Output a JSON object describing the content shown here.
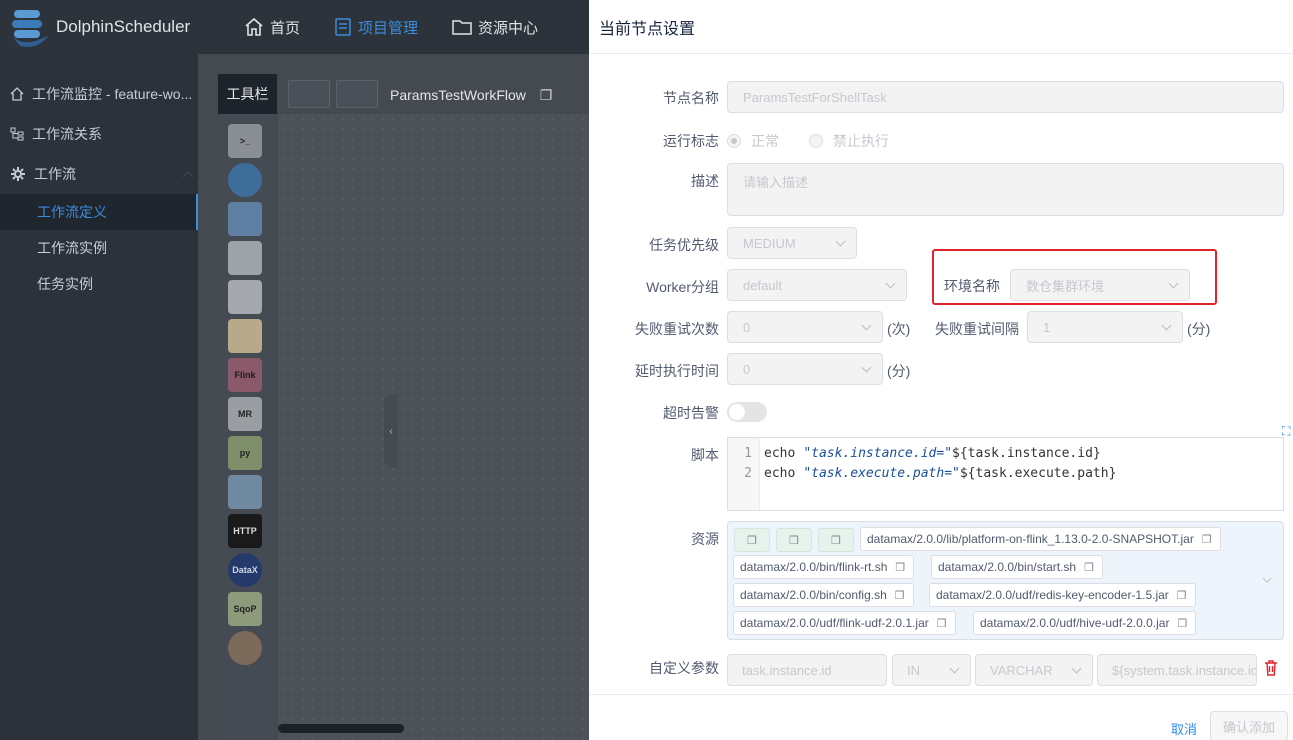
{
  "app": {
    "brand": "DolphinScheduler",
    "nav": [
      {
        "label": "首页",
        "icon": "home-icon"
      },
      {
        "label": "项目管理",
        "icon": "project-icon"
      },
      {
        "label": "资源中心",
        "icon": "folder-icon"
      }
    ]
  },
  "sidebar": {
    "items": [
      {
        "label": "工作流监控 - feature-wo..."
      },
      {
        "label": "工作流关系"
      },
      {
        "label": "工作流"
      }
    ],
    "sub_items": [
      {
        "label": "工作流定义"
      },
      {
        "label": "工作流实例"
      },
      {
        "label": "任务实例"
      }
    ]
  },
  "canvas": {
    "toolbar_title": "工具栏",
    "workflow_name": "ParamsTestWorkFlow",
    "tool_labels": [
      "Flink",
      "MR",
      "py",
      "HTTP",
      "DataX",
      "SqoP"
    ]
  },
  "drawer": {
    "title": "当前节点设置",
    "labels": {
      "node_name": "节点名称",
      "run_flag": "运行标志",
      "description": "描述",
      "priority": "任务优先级",
      "worker_group": "Worker分组",
      "environment": "环境名称",
      "retry_times": "失败重试次数",
      "retry_interval": "失败重试间隔",
      "delay_time": "延时执行时间",
      "timeout_alarm": "超时告警",
      "script": "脚本",
      "resources": "资源",
      "custom_params": "自定义参数"
    },
    "values": {
      "node_name": "ParamsTestForShellTask",
      "run_normal": "正常",
      "run_disabled": "禁止执行",
      "description_placeholder": "请输入描述",
      "priority": "MEDIUM",
      "worker_group": "default",
      "environment": "数仓集群环境",
      "retry_times": "0",
      "retry_times_unit": "(次)",
      "retry_interval": "1",
      "retry_interval_unit": "(分)",
      "delay_time": "0",
      "delay_time_unit": "(分)"
    },
    "script": [
      {
        "line": "1",
        "cmd": "echo",
        "str": "\"task.instance.id=\"",
        "rest": "${task.instance.id}"
      },
      {
        "line": "2",
        "cmd": "echo",
        "str": "\"task.execute.path=\"",
        "rest": "${task.execute.path}"
      }
    ],
    "resources": [
      "datamax/2.0.0/lib/platform-on-flink_1.13.0-2.0-SNAPSHOT.jar",
      "datamax/2.0.0/bin/flink-rt.sh",
      "datamax/2.0.0/bin/start.sh",
      "datamax/2.0.0/bin/config.sh",
      "datamax/2.0.0/udf/redis-key-encoder-1.5.jar",
      "datamax/2.0.0/udf/flink-udf-2.0.1.jar",
      "datamax/2.0.0/udf/hive-udf-2.0.0.jar"
    ],
    "custom_param": {
      "prop": "task.instance.id",
      "direct": "IN",
      "type": "VARCHAR",
      "value": "${system.task.instance.id}"
    },
    "footer": {
      "cancel": "取消",
      "confirm": "确认添加"
    }
  },
  "colors": {
    "accent": "#2d8cf0",
    "highlight_box": "#e0242c",
    "sidebar_bg": "#2b323b"
  }
}
